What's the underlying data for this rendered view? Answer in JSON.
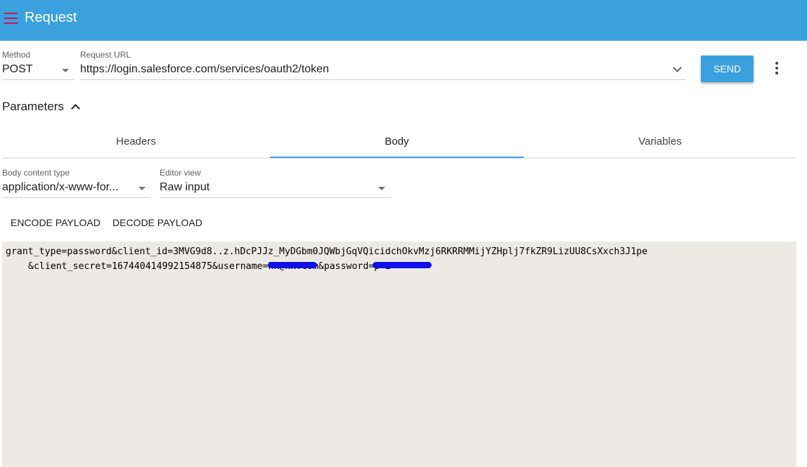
{
  "appbar": {
    "title": "Request",
    "menu_icon": "menu-icon",
    "menu_color": "#c2185b",
    "background": "#3aa1de"
  },
  "request": {
    "method_label": "Method",
    "method_value": "POST",
    "url_label": "Request URL",
    "url_value": "https://login.salesforce.com/services/oauth2/token",
    "send_label": "SEND",
    "more_icon": "more-vert-icon"
  },
  "parameters": {
    "title": "Parameters",
    "expanded": true,
    "tabs": [
      {
        "label": "Headers",
        "active": false
      },
      {
        "label": "Body",
        "active": true
      },
      {
        "label": "Variables",
        "active": false
      }
    ]
  },
  "body": {
    "content_type_label": "Body content type",
    "content_type_value": "application/x-www-for...",
    "editor_view_label": "Editor view",
    "editor_view_value": "Raw input",
    "encode_label": "ENCODE PAYLOAD",
    "decode_label": "DECODE PAYLOAD",
    "payload_line1": "grant_type=password&client_id=3MVG9d8..z.hDcPJJz_MyDGbm0JQWbjGqVQicidchOkvMzj6RKRRMMijYZHplj7fkZR9LizUU8CsXxch3J1pe",
    "payload_line2": "&client_secret=167440414992154875&username=hk@hk.com&password=p         2",
    "redaction_color": "#1010e8"
  }
}
